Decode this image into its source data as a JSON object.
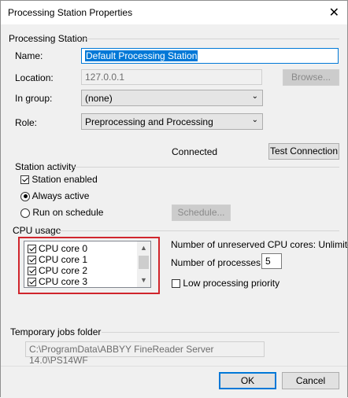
{
  "window": {
    "title": "Processing Station Properties",
    "close_glyph": "✕"
  },
  "processing_station": {
    "group_title": "Processing Station",
    "name_label": "Name:",
    "name_value": "Default Processing Station",
    "location_label": "Location:",
    "location_value": "127.0.0.1",
    "browse_label": "Browse...",
    "group_label": "In group:",
    "group_value": "(none)",
    "role_label": "Role:",
    "role_value": "Preprocessing and Processing",
    "status_text": "Connected",
    "test_connection_label": "Test Connection"
  },
  "station_activity": {
    "group_title": "Station activity",
    "enabled_label": "Station enabled",
    "enabled_checked": true,
    "always_active_label": "Always active",
    "run_on_schedule_label": "Run on schedule",
    "selected_mode": "always_active",
    "schedule_label": "Schedule..."
  },
  "cpu_usage": {
    "group_title": "CPU usage",
    "cores": [
      {
        "label": "CPU core 0",
        "checked": true
      },
      {
        "label": "CPU core 1",
        "checked": true
      },
      {
        "label": "CPU core 2",
        "checked": true
      },
      {
        "label": "CPU core 3",
        "checked": true
      }
    ],
    "unreserved_text": "Number of unreserved CPU cores: Unlimited",
    "processes_label": "Number of processes:",
    "processes_value": "5",
    "low_priority_label": "Low processing priority",
    "low_priority_checked": false,
    "highlight_color": "#d0252c"
  },
  "temp_folder": {
    "group_title": "Temporary jobs folder",
    "path_value": "C:\\ProgramData\\ABBYY FineReader Server 14.0\\PS14WF"
  },
  "footer": {
    "ok_label": "OK",
    "cancel_label": "Cancel"
  },
  "colors": {
    "accent": "#0078d7",
    "selection_bg": "#0078d7",
    "dialog_bg": "#f0f0f0"
  }
}
